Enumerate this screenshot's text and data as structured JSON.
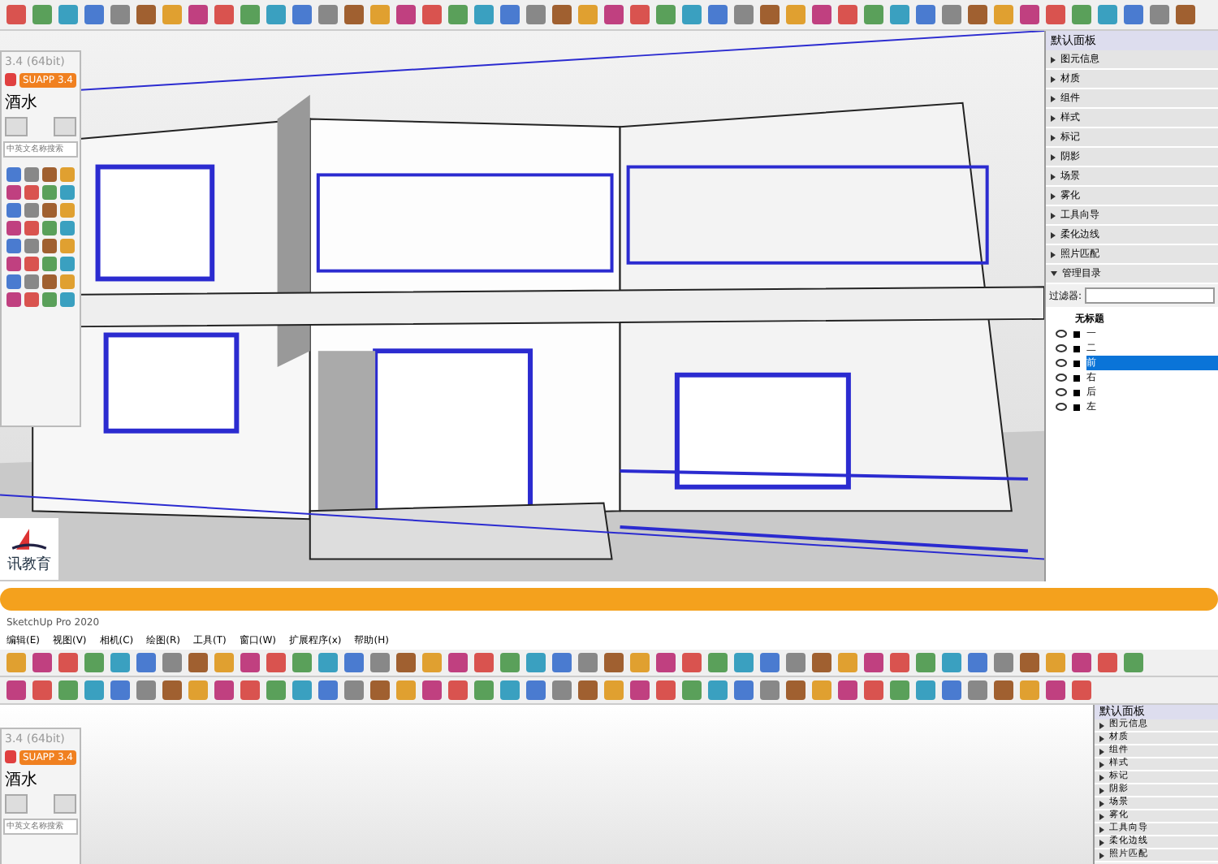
{
  "top": {
    "plugin_panel": {
      "title": "3.4 (64bit)",
      "badge": "SUAPP 3.4",
      "category": "酒水",
      "search_placeholder": "中英文名称搜索"
    },
    "logo_text": "讯教育",
    "tray": {
      "title": "默认面板",
      "sections": [
        {
          "label": "图元信息",
          "expanded": false
        },
        {
          "label": "材质",
          "expanded": false
        },
        {
          "label": "组件",
          "expanded": false
        },
        {
          "label": "样式",
          "expanded": false
        },
        {
          "label": "标记",
          "expanded": false
        },
        {
          "label": "阴影",
          "expanded": false
        },
        {
          "label": "场景",
          "expanded": false
        },
        {
          "label": "雾化",
          "expanded": false
        },
        {
          "label": "工具向导",
          "expanded": false
        },
        {
          "label": "柔化边线",
          "expanded": false
        },
        {
          "label": "照片匹配",
          "expanded": false
        },
        {
          "label": "管理目录",
          "expanded": true
        }
      ],
      "filter_label": "过滤器:",
      "outliner": {
        "root": "无标题",
        "children": [
          {
            "label": "一",
            "selected": false
          },
          {
            "label": "二",
            "selected": false
          },
          {
            "label": "前",
            "selected": true
          },
          {
            "label": "右",
            "selected": false
          },
          {
            "label": "后",
            "selected": false
          },
          {
            "label": "左",
            "selected": false
          }
        ]
      }
    }
  },
  "bottom": {
    "app_title": "SketchUp Pro 2020",
    "menu": [
      "编辑(E)",
      "视图(V)",
      "相机(C)",
      "绘图(R)",
      "工具(T)",
      "窗口(W)",
      "扩展程序(x)",
      "帮助(H)"
    ],
    "plugin_panel": {
      "title": "3.4 (64bit)",
      "badge": "SUAPP 3.4",
      "category": "酒水",
      "search_placeholder": "中英文名称搜索"
    },
    "tray": {
      "title": "默认面板",
      "sections": [
        {
          "label": "图元信息",
          "expanded": false
        },
        {
          "label": "材质",
          "expanded": false
        },
        {
          "label": "组件",
          "expanded": false
        },
        {
          "label": "样式",
          "expanded": false
        },
        {
          "label": "标记",
          "expanded": false
        },
        {
          "label": "阴影",
          "expanded": false
        },
        {
          "label": "场景",
          "expanded": false
        },
        {
          "label": "雾化",
          "expanded": false
        },
        {
          "label": "工具向导",
          "expanded": false
        },
        {
          "label": "柔化边线",
          "expanded": false
        },
        {
          "label": "照片匹配",
          "expanded": false
        }
      ]
    }
  }
}
